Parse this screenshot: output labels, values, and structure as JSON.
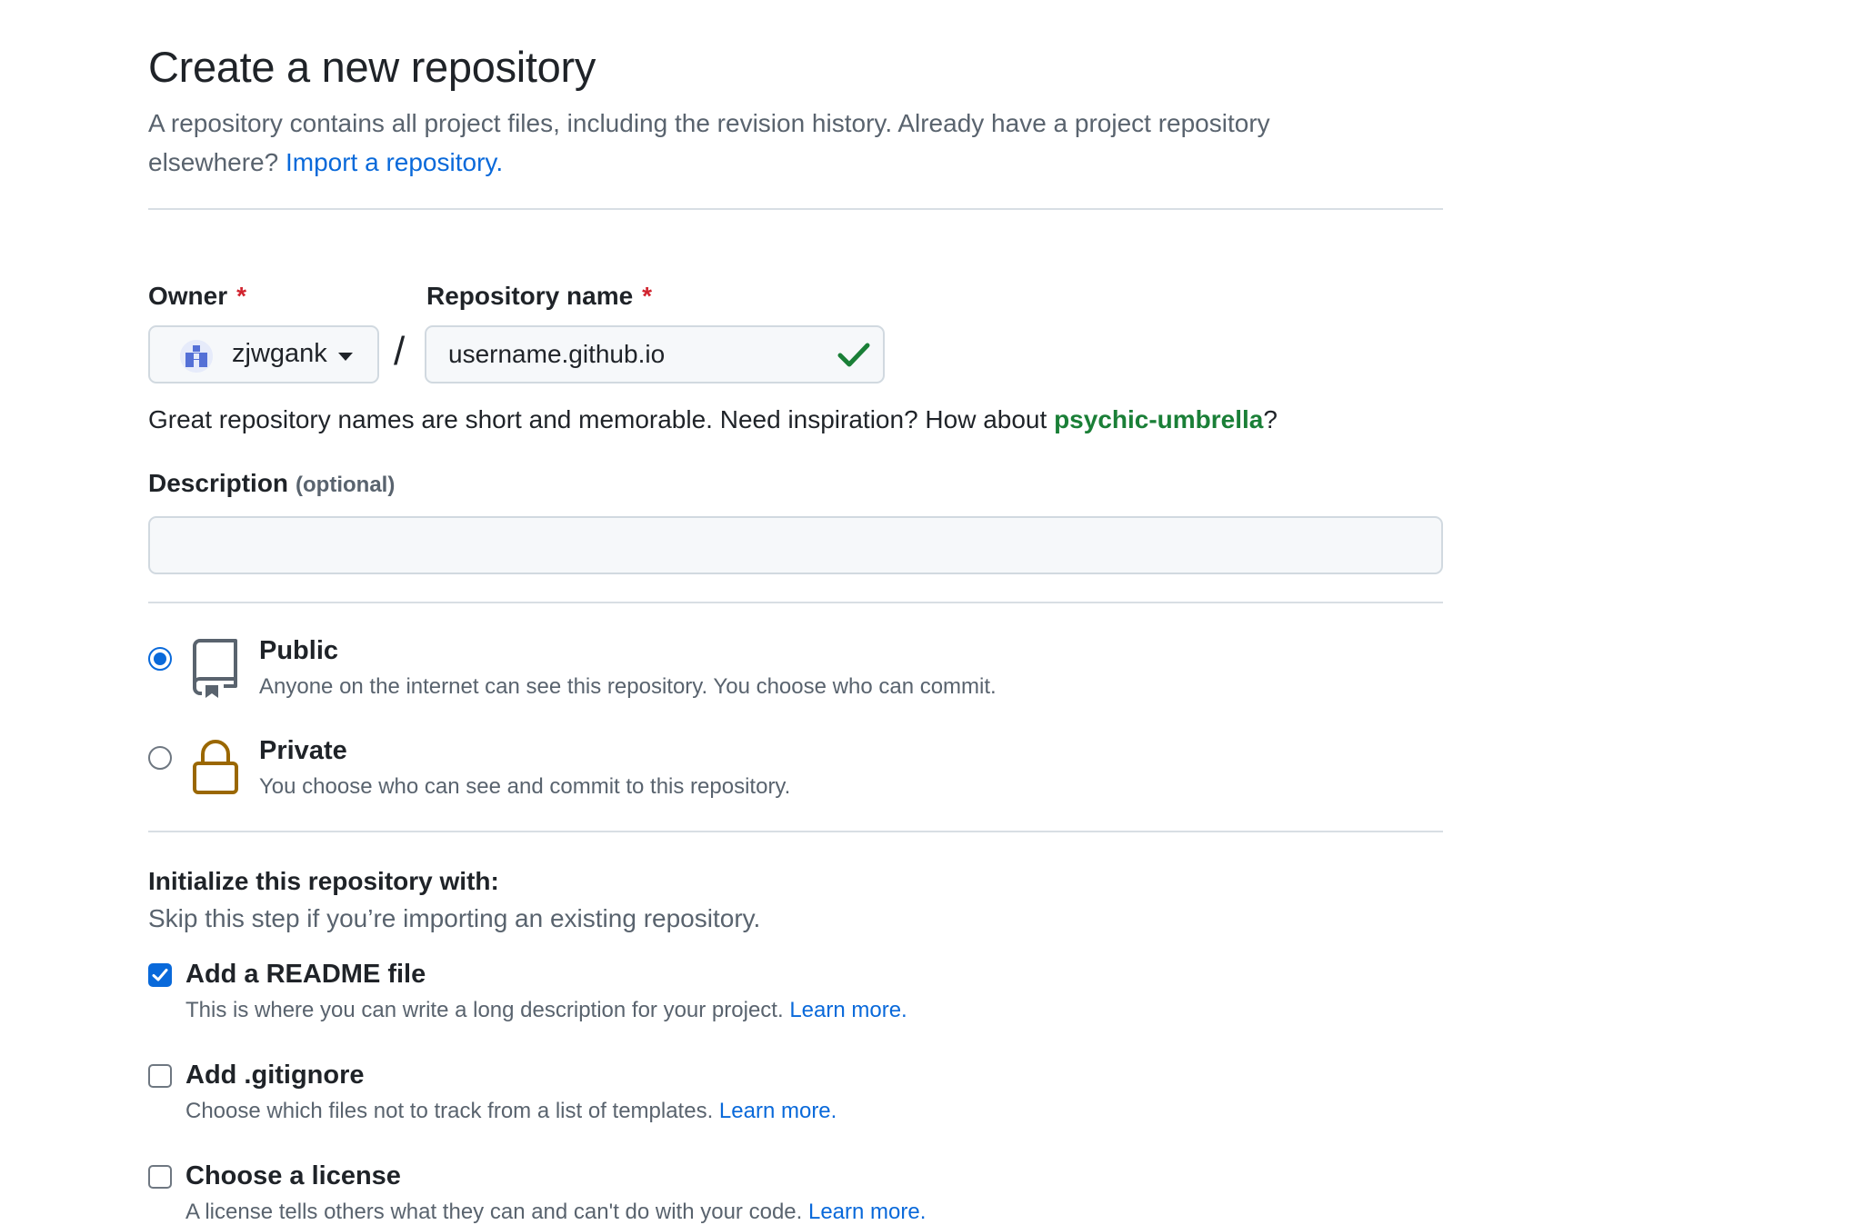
{
  "header": {
    "title": "Create a new repository",
    "subtitle_line1": "A repository contains all project files, including the revision history. Already have a project repository",
    "subtitle_line2": "elsewhere?",
    "import_link": "Import a repository."
  },
  "owner": {
    "label": "Owner",
    "required_mark": "*",
    "value": "zjwgank"
  },
  "repo_name": {
    "label": "Repository name",
    "required_mark": "*",
    "value": "username.github.io",
    "separator": "/"
  },
  "name_hint": {
    "text": "Great repository names are short and memorable. Need inspiration? How about",
    "suggestion": "psychic-umbrella",
    "suffix": "?"
  },
  "description": {
    "label": "Description",
    "optional": "(optional)",
    "value": ""
  },
  "visibility": {
    "selected": "public",
    "options": [
      {
        "id": "public",
        "title": "Public",
        "desc": "Anyone on the internet can see this repository. You choose who can commit."
      },
      {
        "id": "private",
        "title": "Private",
        "desc": "You choose who can see and commit to this repository."
      }
    ]
  },
  "initialize": {
    "title": "Initialize this repository with:",
    "subtitle": "Skip this step if you’re importing an existing repository.",
    "options": [
      {
        "title": "Add a README file",
        "desc": "This is where you can write a long description for your project.",
        "link": "Learn more.",
        "checked": true
      },
      {
        "title": "Add .gitignore",
        "desc": "Choose which files not to track from a list of templates.",
        "link": "Learn more.",
        "checked": false
      },
      {
        "title": "Choose a license",
        "desc": "A license tells others what they can and can't do with your code.",
        "link": "Learn more.",
        "checked": false
      }
    ]
  },
  "colors": {
    "accent": "#0969da",
    "success": "#1a7f37",
    "required": "#d1242f",
    "lock": "#9a6700"
  }
}
